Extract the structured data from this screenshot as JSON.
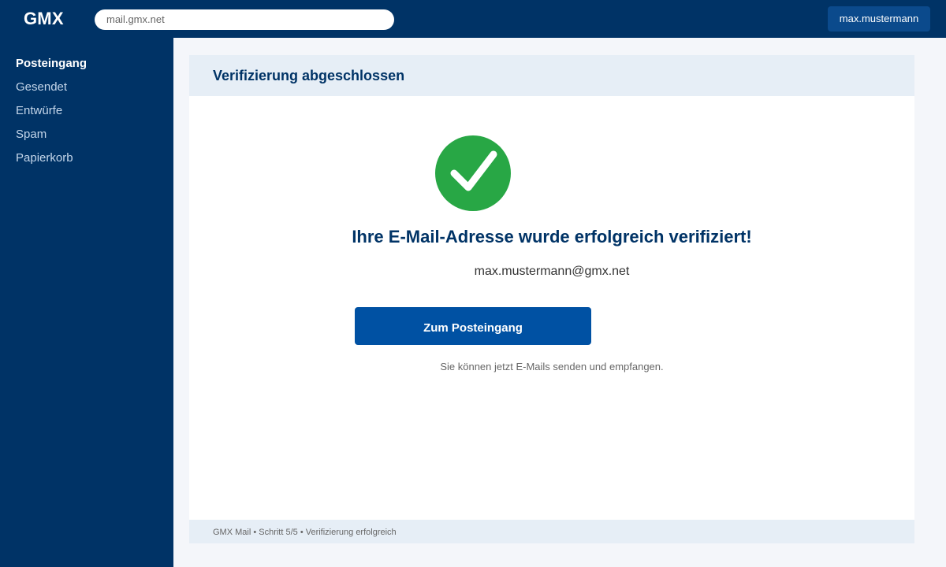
{
  "header": {
    "logo": "GMX",
    "url": "mail.gmx.net",
    "user": "max.mustermann"
  },
  "sidebar": {
    "items": [
      {
        "label": "Posteingang",
        "active": true
      },
      {
        "label": "Gesendet",
        "active": false
      },
      {
        "label": "Entwürfe",
        "active": false
      },
      {
        "label": "Spam",
        "active": false
      },
      {
        "label": "Papierkorb",
        "active": false
      }
    ]
  },
  "card": {
    "title": "Verifizierung abgeschlossen",
    "status_icon": "checkmark-circle-icon",
    "headline": "Ihre E-Mail-Adresse wurde erfolgreich verifiziert!",
    "email": "max.mustermann@gmx.net",
    "cta_label": "Zum Posteingang",
    "hint": "Sie können jetzt E-Mails senden und empfangen.",
    "footer": "GMX Mail • Schritt 5/5 • Verifizierung erfolgreich"
  },
  "colors": {
    "brand": "#003366",
    "accent": "#0051a3",
    "success": "#28a745"
  }
}
